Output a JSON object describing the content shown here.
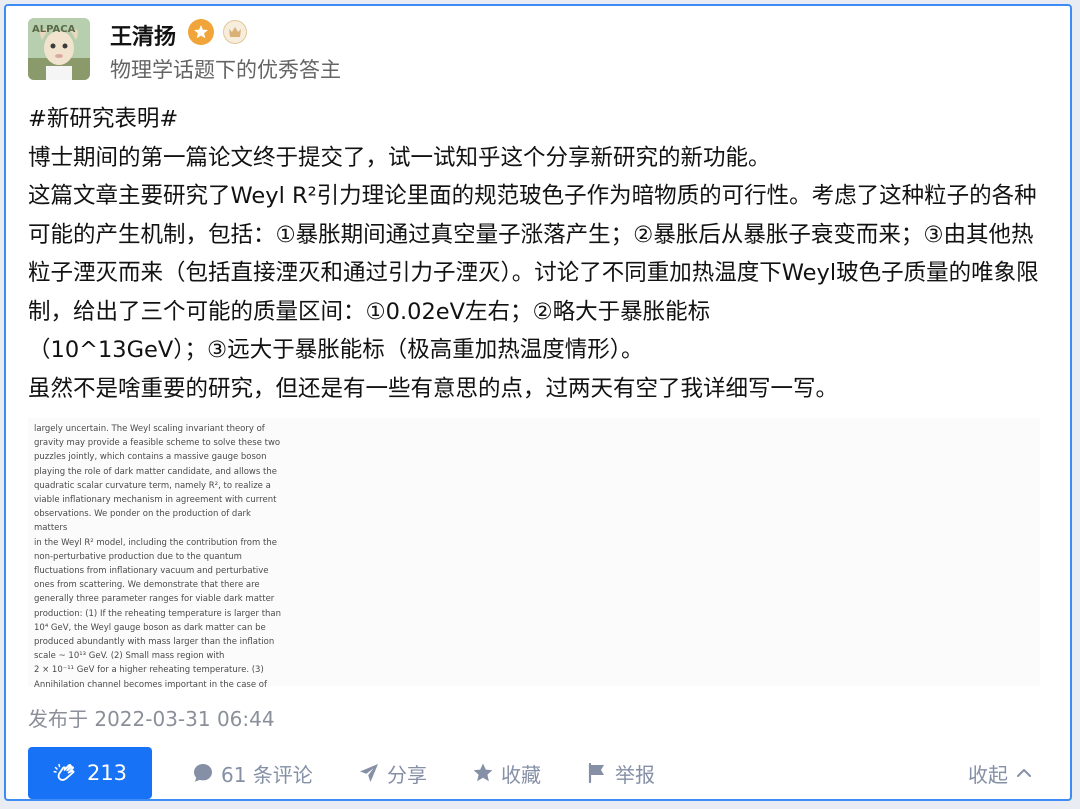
{
  "author": {
    "name": "王清扬",
    "headline": "物理学话题下的优秀答主"
  },
  "content": {
    "paragraphs": [
      "#新研究表明#",
      "博士期间的第一篇论文终于提交了，试一试知乎这个分享新研究的新功能。",
      "这篇文章主要研究了Weyl R²引力理论里面的规范玻色子作为暗物质的可行性。考虑了这种粒子的各种可能的产生机制，包括：①暴胀期间通过真空量子涨落产生；②暴胀后从暴胀子衰变而来；③由其他热粒子湮灭而来（包括直接湮灭和通过引力子湮灭）。讨论了不同重加热温度下Weyl玻色子质量的唯象限制，给出了三个可能的质量区间：①0.02eV左右；②略大于暴胀能标\n（10^13GeV）；③远大于暴胀能标（极高重加热温度情形）。",
      "虽然不是啥重要的研究，但还是有一些有意思的点，过两天有空了我详细写一写。"
    ],
    "paper_excerpt_lines": [
      "largely uncertain. The Weyl scaling invariant theory of",
      "gravity may provide a feasible scheme to solve these two",
      "puzzles jointly, which contains a massive gauge boson",
      "playing the role of dark matter candidate, and allows the",
      "quadratic scalar curvature term, namely R², to realize a",
      "viable inflationary mechanism in agreement with current",
      "observations. We ponder on the production of dark matters",
      "in the Weyl R² model, including the contribution from the",
      "non-perturbative production due to the quantum",
      "fluctuations from inflationary vacuum and perturbative",
      "ones from scattering. We demonstrate that there are",
      "generally three parameter ranges for viable dark matter",
      "production: (1) If the reheating temperature is larger than",
      "10⁴ GeV, the Weyl gauge boson as dark matter can be",
      "produced abundantly with mass larger than the inflation",
      "scale ~ 10¹³ GeV. (2) Small mass region with",
      "2 × 10⁻¹¹ GeV for a higher reheating temperature. (3)",
      "Annihilation channel becomes important in the case of"
    ],
    "publish_time": "发布于 2022-03-31 06:44"
  },
  "actions": {
    "like_count": "213",
    "comments": "61 条评论",
    "share": "分享",
    "collect": "收藏",
    "report": "举报",
    "collapse": "收起"
  },
  "colors": {
    "accent": "#1772f6",
    "border": "#3d8cf5",
    "muted": "#8590a6"
  }
}
